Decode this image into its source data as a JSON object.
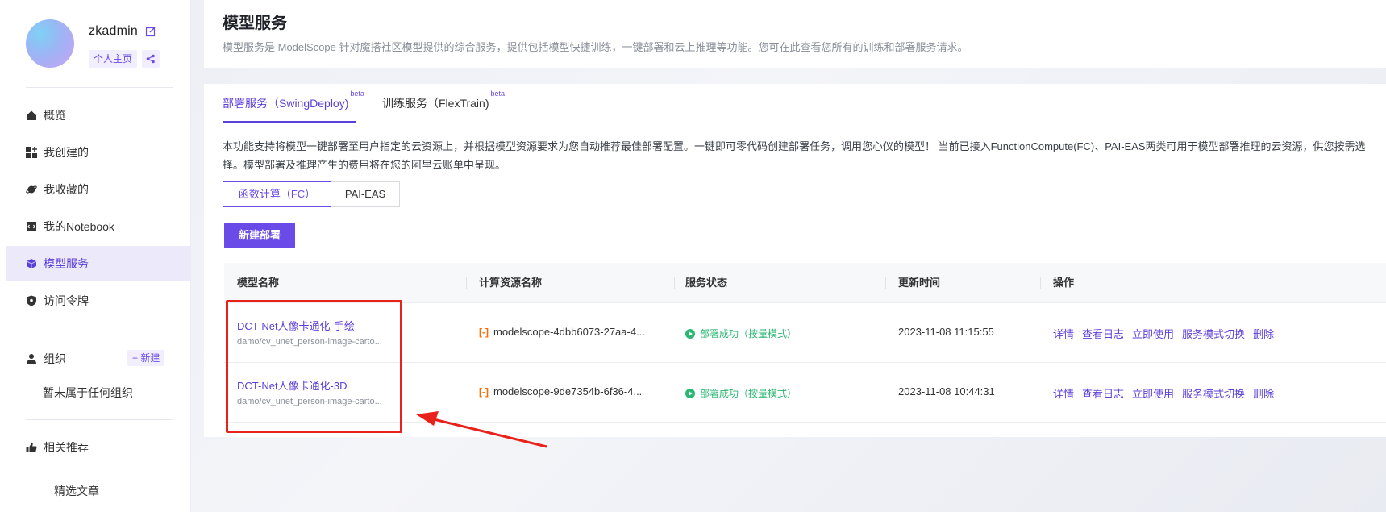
{
  "sidebar": {
    "username": "zkadmin",
    "home_link": "个人主页",
    "nav": [
      {
        "label": "概览",
        "icon": "home-icon"
      },
      {
        "label": "我创建的",
        "icon": "grid-add-icon"
      },
      {
        "label": "我收藏的",
        "icon": "planet-icon"
      },
      {
        "label": "我的Notebook",
        "icon": "notebook-icon"
      },
      {
        "label": "模型服务",
        "icon": "cube-icon",
        "active": true
      },
      {
        "label": "访问令牌",
        "icon": "shield-icon"
      }
    ],
    "org_label": "组织",
    "org_new": "+ 新建",
    "org_empty": "暂未属于任何组织",
    "recommend_label": "相关推荐",
    "recommend_sub": "精选文章"
  },
  "header": {
    "title": "模型服务",
    "description": "模型服务是 ModelScope 针对魔搭社区模型提供的综合服务，提供包括模型快捷训练，一键部署和云上推理等功能。您可在此查看您所有的训练和部署服务请求。"
  },
  "tabs": [
    {
      "label": "部署服务（SwingDeploy)",
      "badge": "beta",
      "active": true
    },
    {
      "label": "训练服务（FlexTrain)",
      "badge": "beta",
      "active": false
    }
  ],
  "intro": "本功能支持将模型一键部署至用户指定的云资源上，并根据模型资源要求为您自动推荐最佳部署配置。一键即可零代码创建部署任务，调用您心仪的模型！ 当前已接入FunctionCompute(FC)、PAI-EAS两类可用于模型部署推理的云资源，供您按需选择。模型部署及推理产生的费用将在您的阿里云账单中呈现。",
  "segments": [
    "函数计算（FC）",
    "PAI-EAS"
  ],
  "new_button": "新建部署",
  "table": {
    "columns": [
      "模型名称",
      "计算资源名称",
      "服务状态",
      "更新时间",
      "操作"
    ],
    "rows": [
      {
        "name": "DCT-Net人像卡通化-手绘",
        "path": "damo/cv_unet_person-image-carto...",
        "resource": "modelscope-4dbb6073-27aa-4...",
        "status": "部署成功（按量模式）",
        "time": "2023-11-08 11:15:55",
        "ops": [
          "详情",
          "查看日志",
          "立即使用",
          "服务模式切换",
          "删除"
        ]
      },
      {
        "name": "DCT-Net人像卡通化-3D",
        "path": "damo/cv_unet_person-image-carto...",
        "resource": "modelscope-9de7354b-6f36-4...",
        "status": "部署成功（按量模式）",
        "time": "2023-11-08 10:44:31",
        "ops": [
          "详情",
          "查看日志",
          "立即使用",
          "服务模式切换",
          "删除"
        ]
      }
    ]
  },
  "colors": {
    "accent": "#6a4be7",
    "success": "#2bb673",
    "annotation": "#e8221b"
  }
}
